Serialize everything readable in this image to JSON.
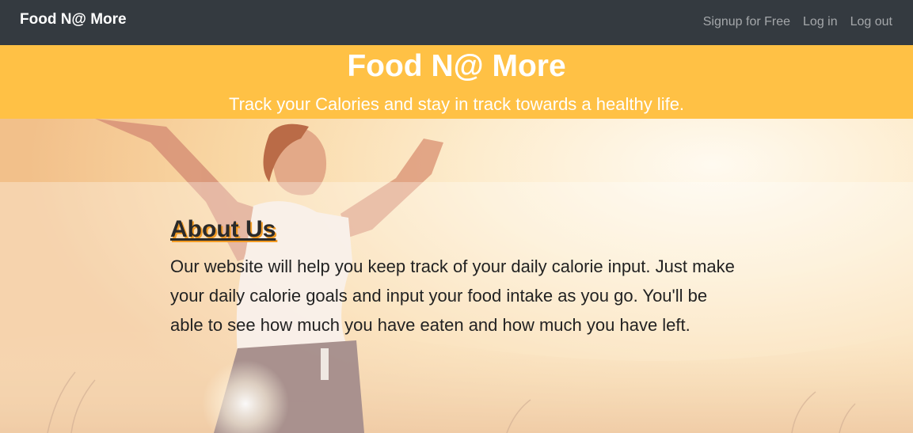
{
  "navbar": {
    "brand": "Food N@ More",
    "links": [
      "Signup for Free",
      "Log in",
      "Log out"
    ]
  },
  "hero": {
    "title": "Food N@ More",
    "subtitle": "Track your Calories and stay in track towards a healthy life."
  },
  "about": {
    "heading": "About Us",
    "text": "Our website will help you keep track of your daily calorie input. Just make your daily calorie goals and input your food intake as you go. You'll be able to see how much you have eaten and how much you have left."
  },
  "colors": {
    "navbar_bg": "#343a40",
    "hero_bg": "#ffc145",
    "heading_shadow": "#f29b24"
  },
  "background_image": "woman-arms-raised-sunset-field-photo"
}
